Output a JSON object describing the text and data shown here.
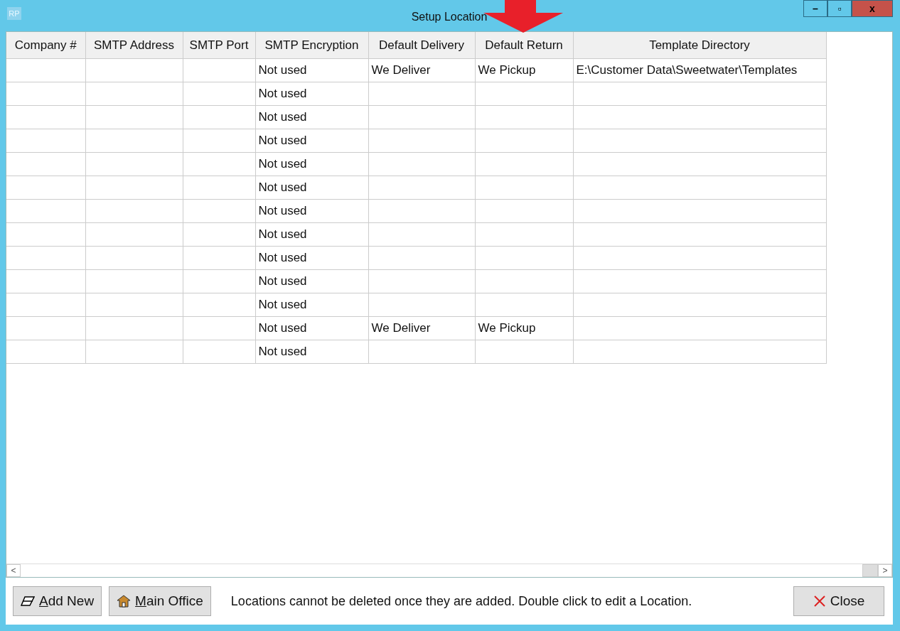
{
  "window": {
    "icon_text": "RP",
    "title": "Setup Location",
    "controls": [
      "–",
      "▫",
      "x"
    ]
  },
  "table": {
    "columns": [
      "Company #",
      "SMTP Address",
      "SMTP Port",
      "SMTP Encryption",
      "Default Delivery",
      "Default Return",
      "Template Directory"
    ],
    "rows": [
      {
        "cells": [
          null,
          null,
          null,
          "Not used",
          "We Deliver",
          "We Pickup",
          "E:\\Customer Data\\Sweetwater\\Templates"
        ]
      },
      {
        "cells": [
          null,
          null,
          null,
          "Not used",
          null,
          null,
          null
        ]
      },
      {
        "cells": [
          null,
          null,
          null,
          "Not used",
          null,
          null,
          null
        ]
      },
      {
        "cells": [
          null,
          null,
          null,
          "Not used",
          null,
          null,
          null
        ]
      },
      {
        "cells": [
          null,
          null,
          null,
          "Not used",
          null,
          null,
          null
        ]
      },
      {
        "cells": [
          null,
          null,
          null,
          "Not used",
          null,
          null,
          null
        ]
      },
      {
        "cells": [
          null,
          null,
          null,
          "Not used",
          null,
          null,
          null
        ]
      },
      {
        "cells": [
          null,
          null,
          null,
          "Not used",
          null,
          null,
          null
        ]
      },
      {
        "cells": [
          null,
          null,
          null,
          "Not used",
          null,
          null,
          null
        ]
      },
      {
        "cells": [
          null,
          null,
          null,
          "Not used",
          null,
          null,
          null
        ]
      },
      {
        "cells": [
          null,
          null,
          null,
          "Not used",
          null,
          null,
          null
        ]
      },
      {
        "cells": [
          null,
          null,
          null,
          "Not used",
          "We Deliver",
          "We Pickup",
          null
        ]
      },
      {
        "cells": [
          null,
          null,
          null,
          "Not used",
          null,
          null,
          null
        ]
      }
    ],
    "scrollbar": {
      "left": "<",
      "right": ">"
    }
  },
  "footer": {
    "buttons": [
      {
        "kind": "add",
        "label": "Add New"
      },
      {
        "kind": "office",
        "label": "Main Office"
      }
    ],
    "message": "Locations cannot be deleted once they are added. Double click to edit a Location.",
    "close_button": {
      "label": "Close"
    }
  },
  "annotation": {
    "kind": "arrow"
  }
}
